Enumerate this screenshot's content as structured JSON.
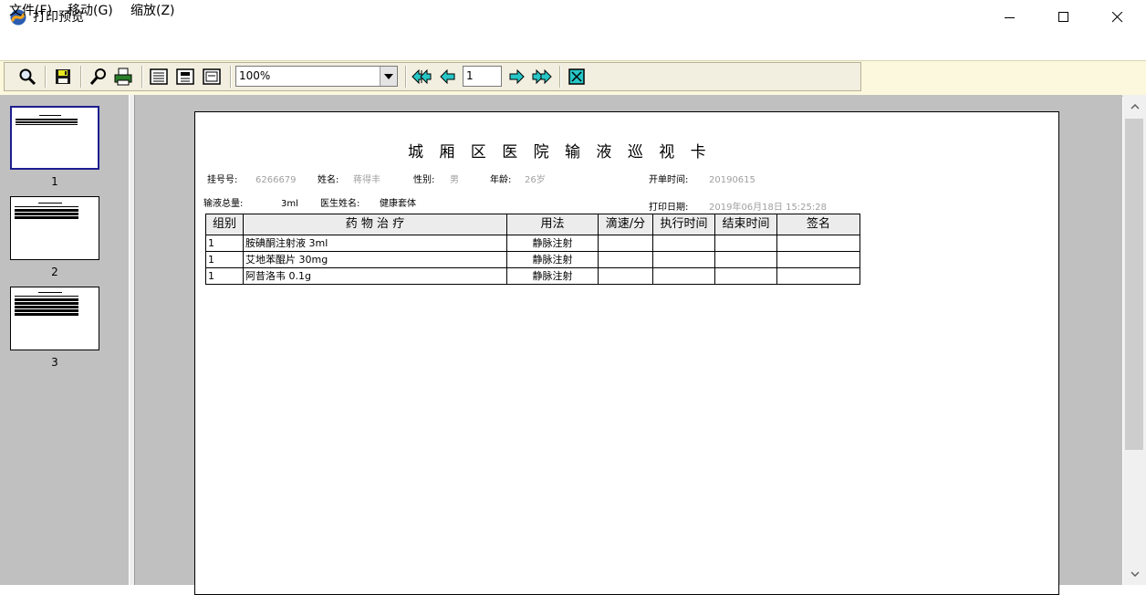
{
  "window": {
    "title": "打印预览"
  },
  "menu": {
    "items": [
      "文件(F)",
      "移动(G)",
      "缩放(Z)"
    ]
  },
  "toolbar": {
    "zoom_value": "100%",
    "page_value": "1"
  },
  "thumbnails": [
    "1",
    "2",
    "3"
  ],
  "document": {
    "title": "城 厢 区 医 院 输 液 巡 视 卡",
    "fields": {
      "reg_no_label": "挂号号:",
      "reg_no": "6266679",
      "name_label": "姓名:",
      "name": "蒋得丰",
      "sex_label": "性别:",
      "sex": "男",
      "age_label": "年龄:",
      "age": "26岁",
      "open_time_label": "开单时间:",
      "open_time": "20190615",
      "total_label": "输液总量:",
      "total": "3ml",
      "doctor_label": "医生姓名:",
      "doctor": "健康套体",
      "print_date_label": "打印日期:",
      "print_date": "2019年06月18日  15:25:28"
    },
    "table": {
      "headers": [
        "组别",
        "药 物 治 疗",
        "用法",
        "滴速/分",
        "执行时间",
        "结束时间",
        "签名"
      ],
      "rows": [
        [
          "1",
          "胺碘酮注射液 3ml",
          "静脉注射",
          "",
          "",
          "",
          ""
        ],
        [
          "1",
          "艾地苯醌片 30mg",
          "静脉注射",
          "",
          "",
          "",
          ""
        ],
        [
          "1",
          "阿昔洛韦 0.1g",
          "静脉注射",
          "",
          "",
          "",
          ""
        ]
      ]
    }
  }
}
